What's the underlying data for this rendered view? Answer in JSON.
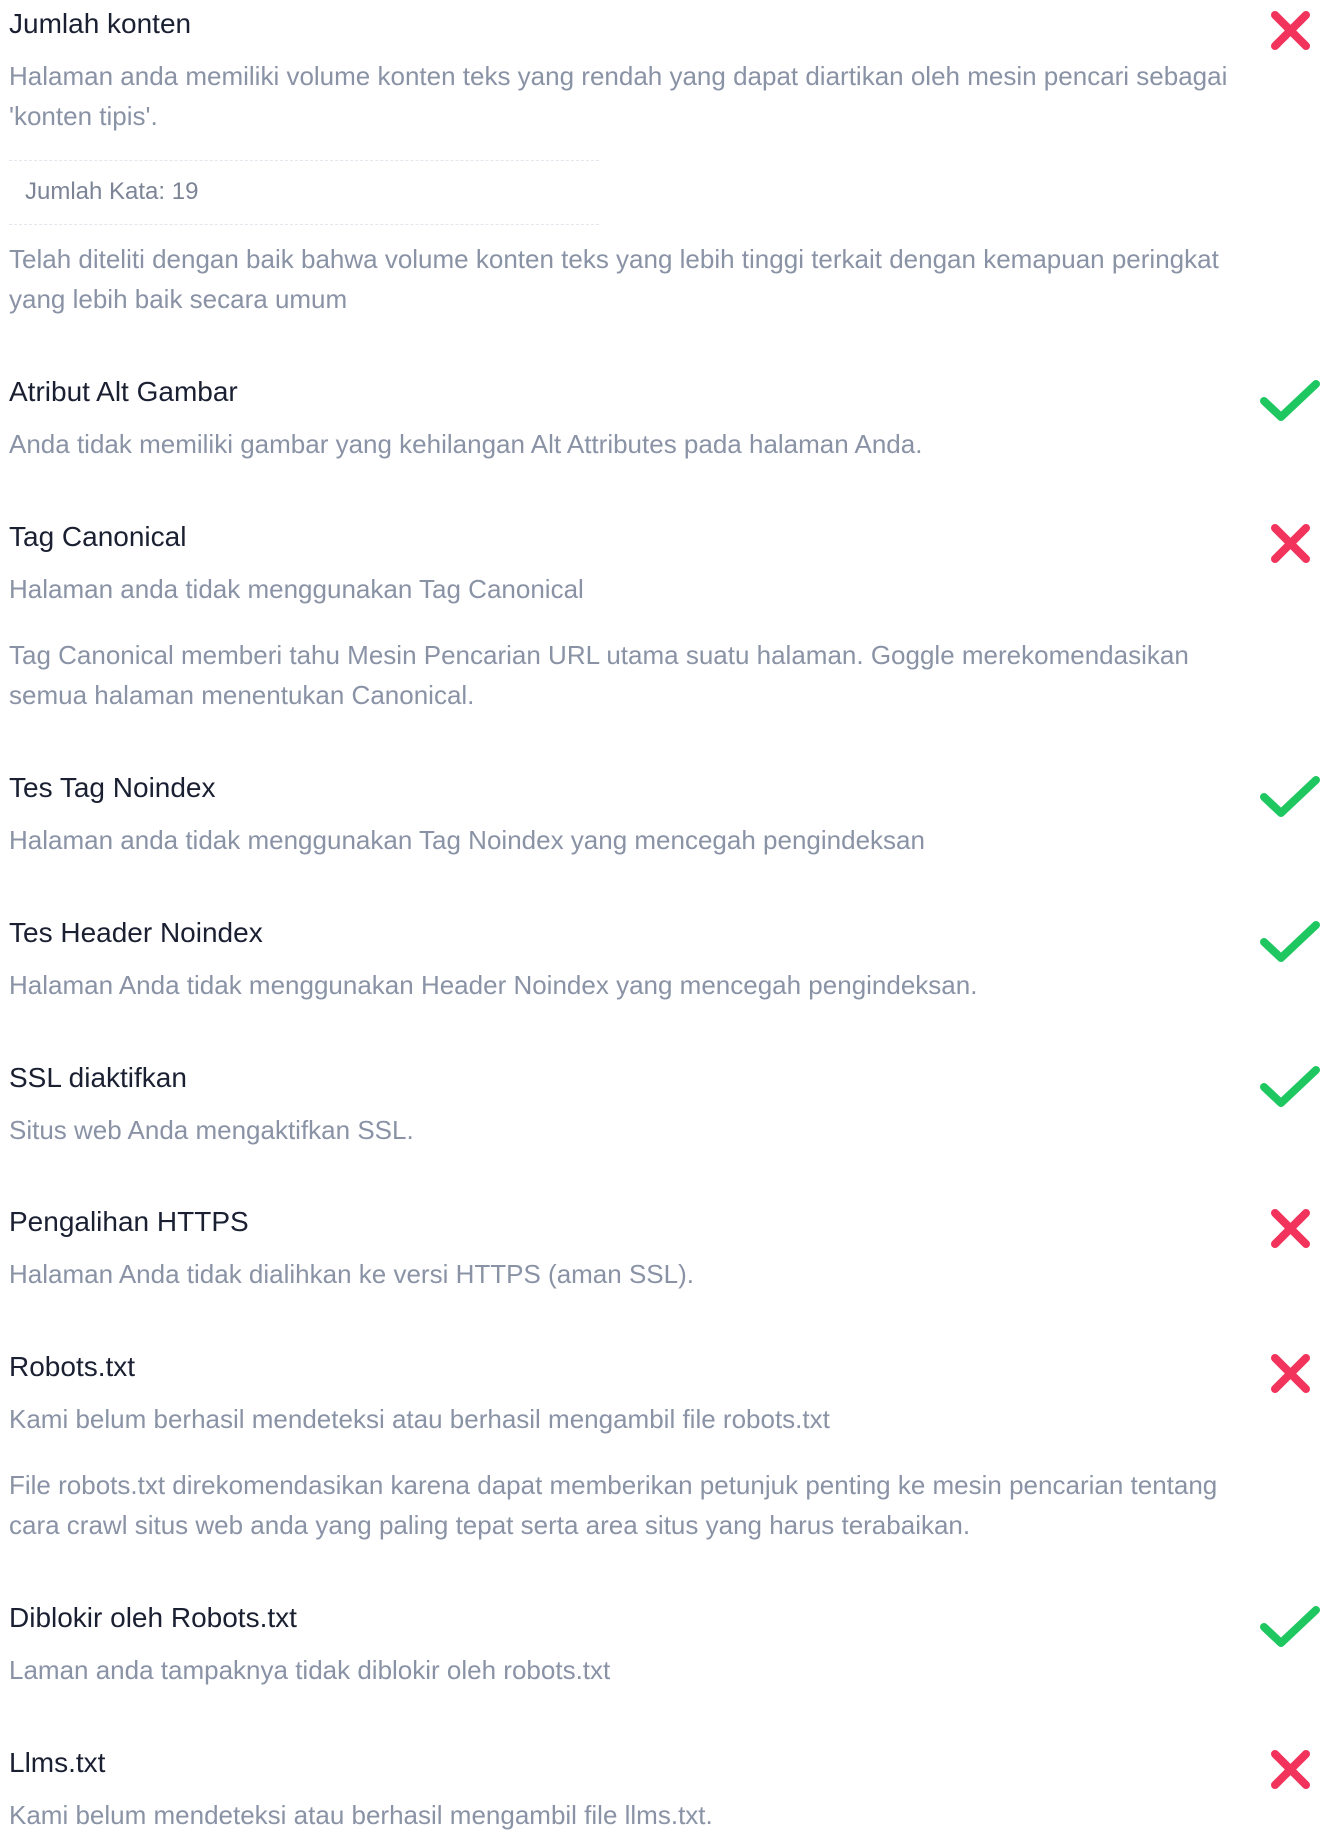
{
  "colors": {
    "pass": "#1ec760",
    "fail": "#f2335c",
    "title": "#1a2032",
    "text": "#8a93a6"
  },
  "items": [
    {
      "title": "Jumlah konten",
      "status": "fail",
      "icon": "cross-icon",
      "description": "Halaman anda memiliki volume konten teks yang rendah yang dapat diartikan oleh mesin pencari sebagai 'konten tipis'.",
      "detail": "Jumlah Kata: 19",
      "note": "Telah diteliti dengan baik bahwa volume konten teks yang lebih tinggi terkait dengan kemapuan peringkat yang lebih baik secara umum"
    },
    {
      "title": "Atribut Alt Gambar",
      "status": "pass",
      "icon": "check-icon",
      "description": "Anda tidak memiliki gambar yang kehilangan Alt Attributes pada halaman Anda."
    },
    {
      "title": "Tag Canonical",
      "status": "fail",
      "icon": "cross-icon",
      "description": "Halaman anda tidak menggunakan Tag Canonical",
      "note": "Tag Canonical memberi tahu Mesin Pencarian URL utama suatu halaman. Goggle merekomendasikan semua halaman menentukan Canonical."
    },
    {
      "title": "Tes Tag Noindex",
      "status": "pass",
      "icon": "check-icon",
      "description": "Halaman anda tidak menggunakan Tag Noindex yang mencegah pengindeksan"
    },
    {
      "title": "Tes Header Noindex",
      "status": "pass",
      "icon": "check-icon",
      "description": "Halaman Anda tidak menggunakan Header Noindex yang mencegah pengindeksan."
    },
    {
      "title": "SSL diaktifkan",
      "status": "pass",
      "icon": "check-icon",
      "description": "Situs web Anda mengaktifkan SSL."
    },
    {
      "title": "Pengalihan HTTPS",
      "status": "fail",
      "icon": "cross-icon",
      "description": "Halaman Anda tidak dialihkan ke versi HTTPS (aman SSL)."
    },
    {
      "title": "Robots.txt",
      "status": "fail",
      "icon": "cross-icon",
      "description": "Kami belum berhasil mendeteksi atau berhasil mengambil file robots.txt",
      "note": "File robots.txt direkomendasikan karena dapat memberikan petunjuk penting ke mesin pencarian tentang cara crawl situs web anda yang paling tepat serta area situs yang harus terabaikan."
    },
    {
      "title": "Diblokir oleh Robots.txt",
      "status": "pass",
      "icon": "check-icon",
      "description": "Laman anda tampaknya tidak diblokir oleh robots.txt"
    },
    {
      "title": "Llms.txt",
      "status": "fail",
      "icon": "cross-icon",
      "description": "Kami belum mendeteksi atau berhasil mengambil file llms.txt."
    }
  ]
}
